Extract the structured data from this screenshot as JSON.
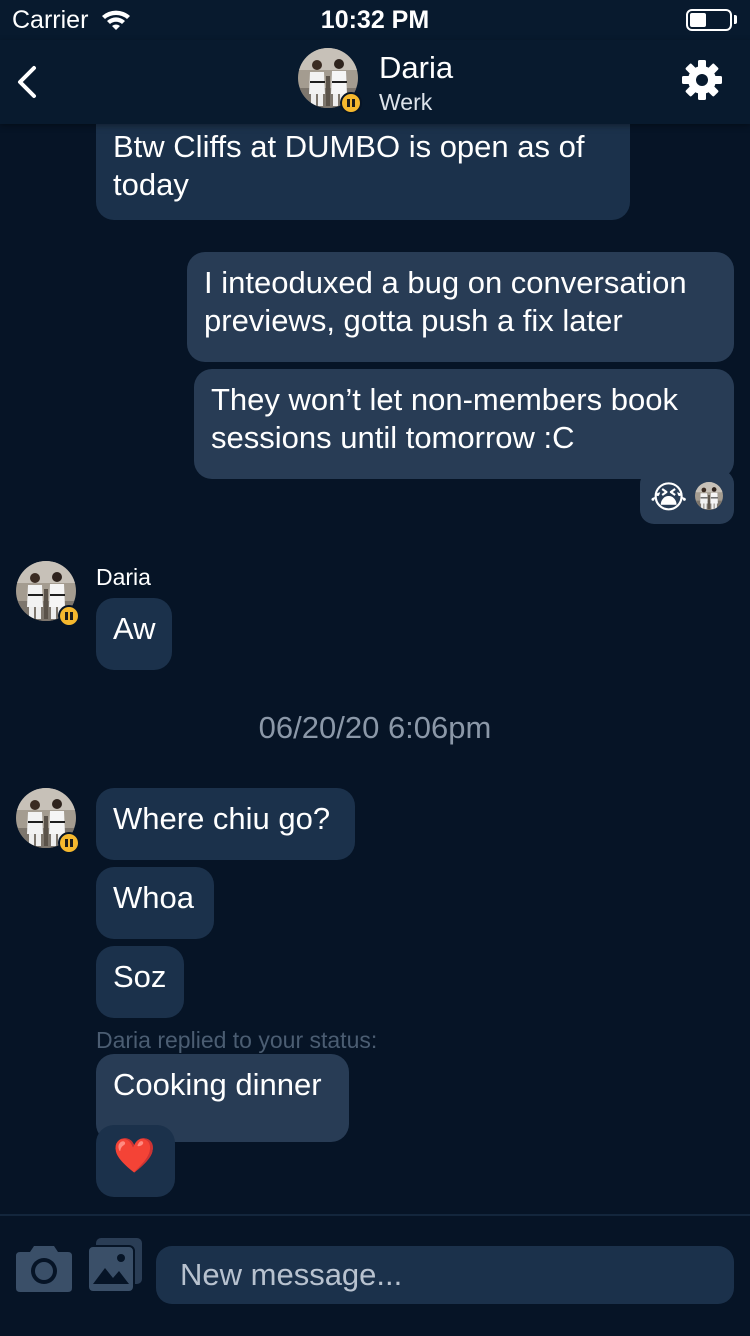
{
  "status_bar": {
    "carrier": "Carrier",
    "time": "10:32 PM"
  },
  "header": {
    "back_icon": "chevron-left-icon",
    "name": "Daria",
    "status": "Werk",
    "settings_icon": "gear-icon"
  },
  "messages": [
    {
      "text": "Btw Cliffs at DUMBO is open as of today",
      "direction": "incoming"
    },
    {
      "text": "I inteoduxed a bug on conversation previews, gotta push a fix later",
      "direction": "outgoing"
    },
    {
      "text": "They won’t let non-members book sessions until tomorrow :C",
      "direction": "outgoing",
      "reaction": "😭"
    },
    {
      "sender": "Daria",
      "text": "Aw",
      "direction": "incoming"
    },
    {
      "text": "Where chiu go?",
      "direction": "incoming"
    },
    {
      "text": "Whoa",
      "direction": "incoming"
    },
    {
      "text": "Soz",
      "direction": "incoming"
    },
    {
      "text": "Cooking dinner",
      "direction": "incoming",
      "reply_note": "Daria replied to your status:"
    },
    {
      "text": "❤️",
      "direction": "incoming"
    }
  ],
  "timestamp": "06/20/20 6:06pm",
  "composer": {
    "placeholder": "New message...",
    "camera_icon": "camera-icon",
    "gallery_icon": "image-gallery-icon"
  },
  "colors": {
    "background": "#061426",
    "incoming_bubble": "#1b314b",
    "outgoing_bubble": "#283c55",
    "status_badge": "#f5b82e",
    "timestamp_text": "#8b98a8"
  }
}
